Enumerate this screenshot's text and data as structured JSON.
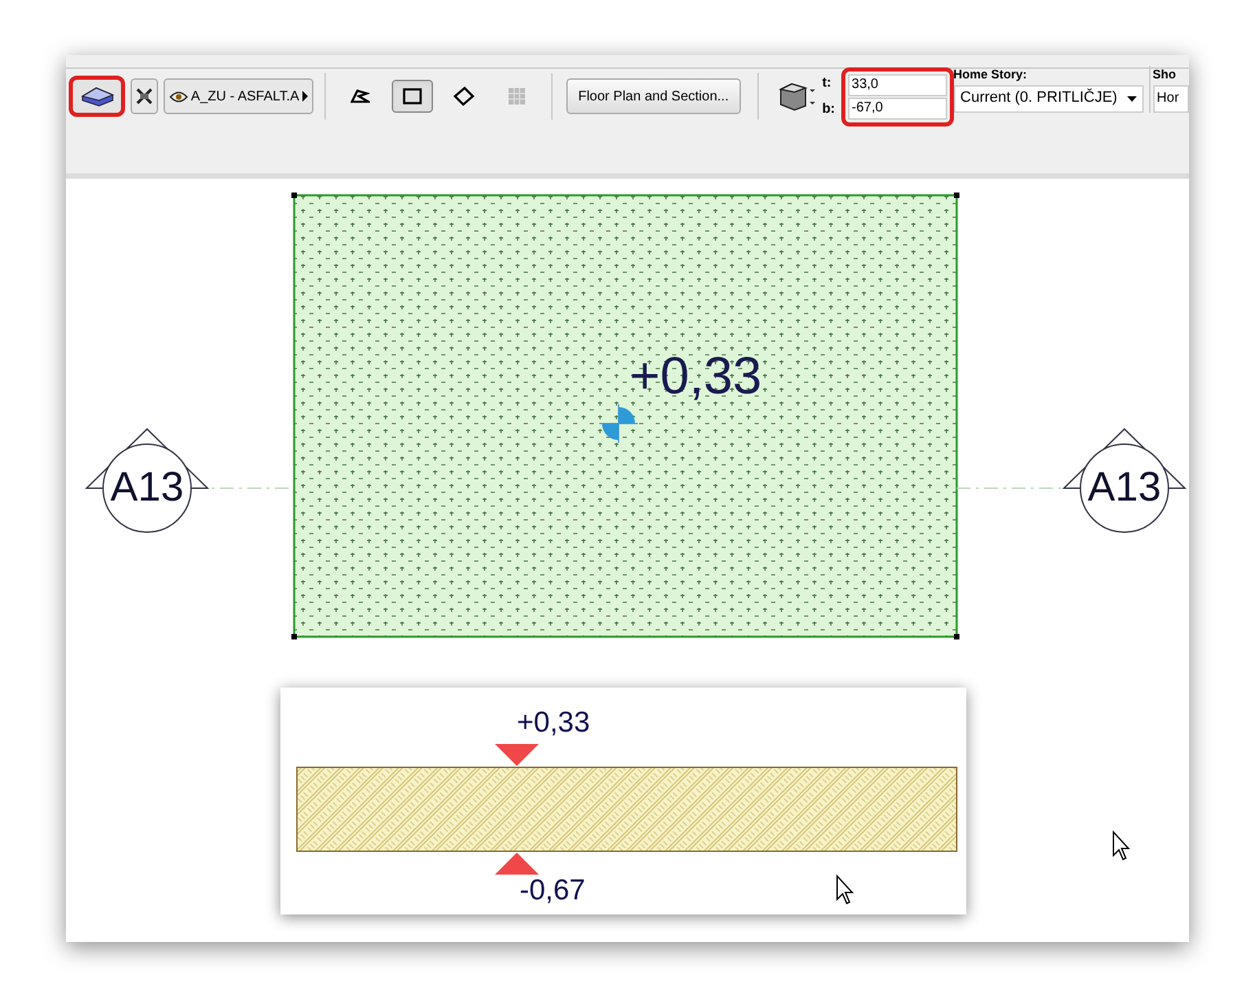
{
  "toolbar": {
    "slab_tool_button": {
      "highlighted": true
    },
    "layer_button": {
      "label": "A_ZU - ASFALT.A"
    },
    "geometry_methods": [
      {
        "kind": "polygon",
        "selected": false
      },
      {
        "kind": "rectangle",
        "selected": true
      },
      {
        "kind": "rotated",
        "selected": false
      },
      {
        "kind": "grid",
        "selected": false
      }
    ],
    "section_button": {
      "label": "Floor Plan and Section..."
    },
    "offsets": {
      "highlighted": true,
      "top_label": "t:",
      "top_value": "33,0",
      "bottom_label": "b:",
      "bottom_value": "-67,0"
    },
    "home_story": {
      "label": "Home Story:",
      "value": "Current (0. PRITLIČJE)"
    },
    "show": {
      "label": "Sho",
      "value": "Hor"
    }
  },
  "plan": {
    "elevation_label": "+0,33",
    "section_markers": [
      {
        "label": "A13"
      },
      {
        "label": "A13"
      }
    ]
  },
  "section_view": {
    "top_label": "+0,33",
    "bottom_label": "-0,67"
  }
}
